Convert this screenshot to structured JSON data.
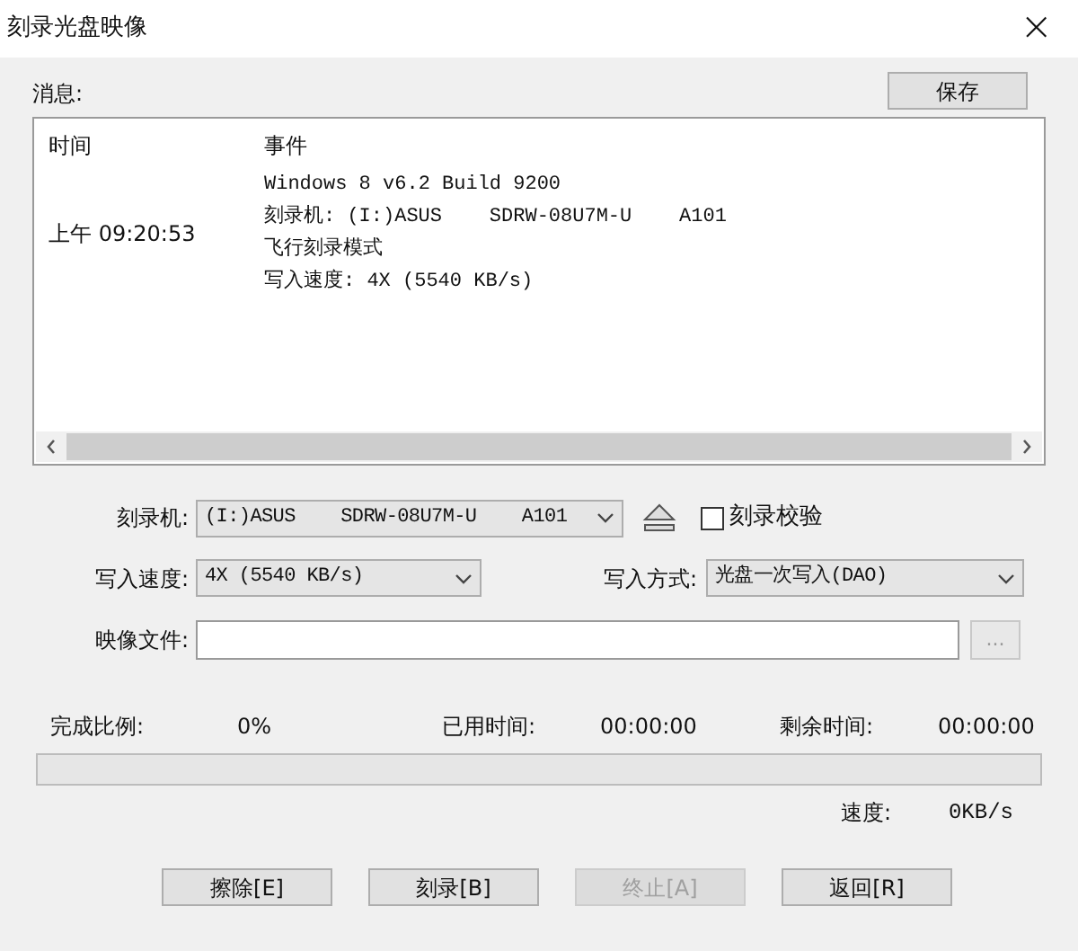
{
  "window": {
    "title": "刻录光盘映像",
    "close": "×"
  },
  "log": {
    "label": "消息:",
    "save_button": "保存",
    "columns": [
      "时间",
      "事件"
    ],
    "rows": [
      {
        "time": "上午 09:20:53",
        "events": [
          "Windows 8 v6.2 Build 9200",
          "刻录机: (I:)ASUS    SDRW-08U7M-U    A101",
          "飞行刻录模式",
          "写入速度: 4X (5540 KB/s)"
        ]
      }
    ]
  },
  "burner": {
    "label": "刻录机:",
    "value": "(I:)ASUS    SDRW-08U7M-U    A101"
  },
  "verify": {
    "label": "刻录校验",
    "checked": false
  },
  "speed": {
    "label": "写入速度:",
    "value": "4X (5540 KB/s)"
  },
  "mode": {
    "label": "写入方式:",
    "value": "光盘一次写入(DAO)"
  },
  "image_file": {
    "label": "映像文件:",
    "browse": "..."
  },
  "stats": [
    {
      "label": "完成比例:",
      "value": "0%"
    },
    {
      "label": "已用时间:",
      "value": "00:00:00"
    },
    {
      "label": "剩余时间:",
      "value": "00:00:00"
    }
  ],
  "progress": {
    "level": 0
  },
  "rate": {
    "label": "速度:",
    "value": "0KB/s"
  },
  "buttons": [
    {
      "label": "擦除[E]",
      "disabled": false
    },
    {
      "label": "刻录[B]",
      "disabled": false
    },
    {
      "label": "终止[A]",
      "disabled": true
    },
    {
      "label": "返回[R]",
      "disabled": false
    }
  ]
}
